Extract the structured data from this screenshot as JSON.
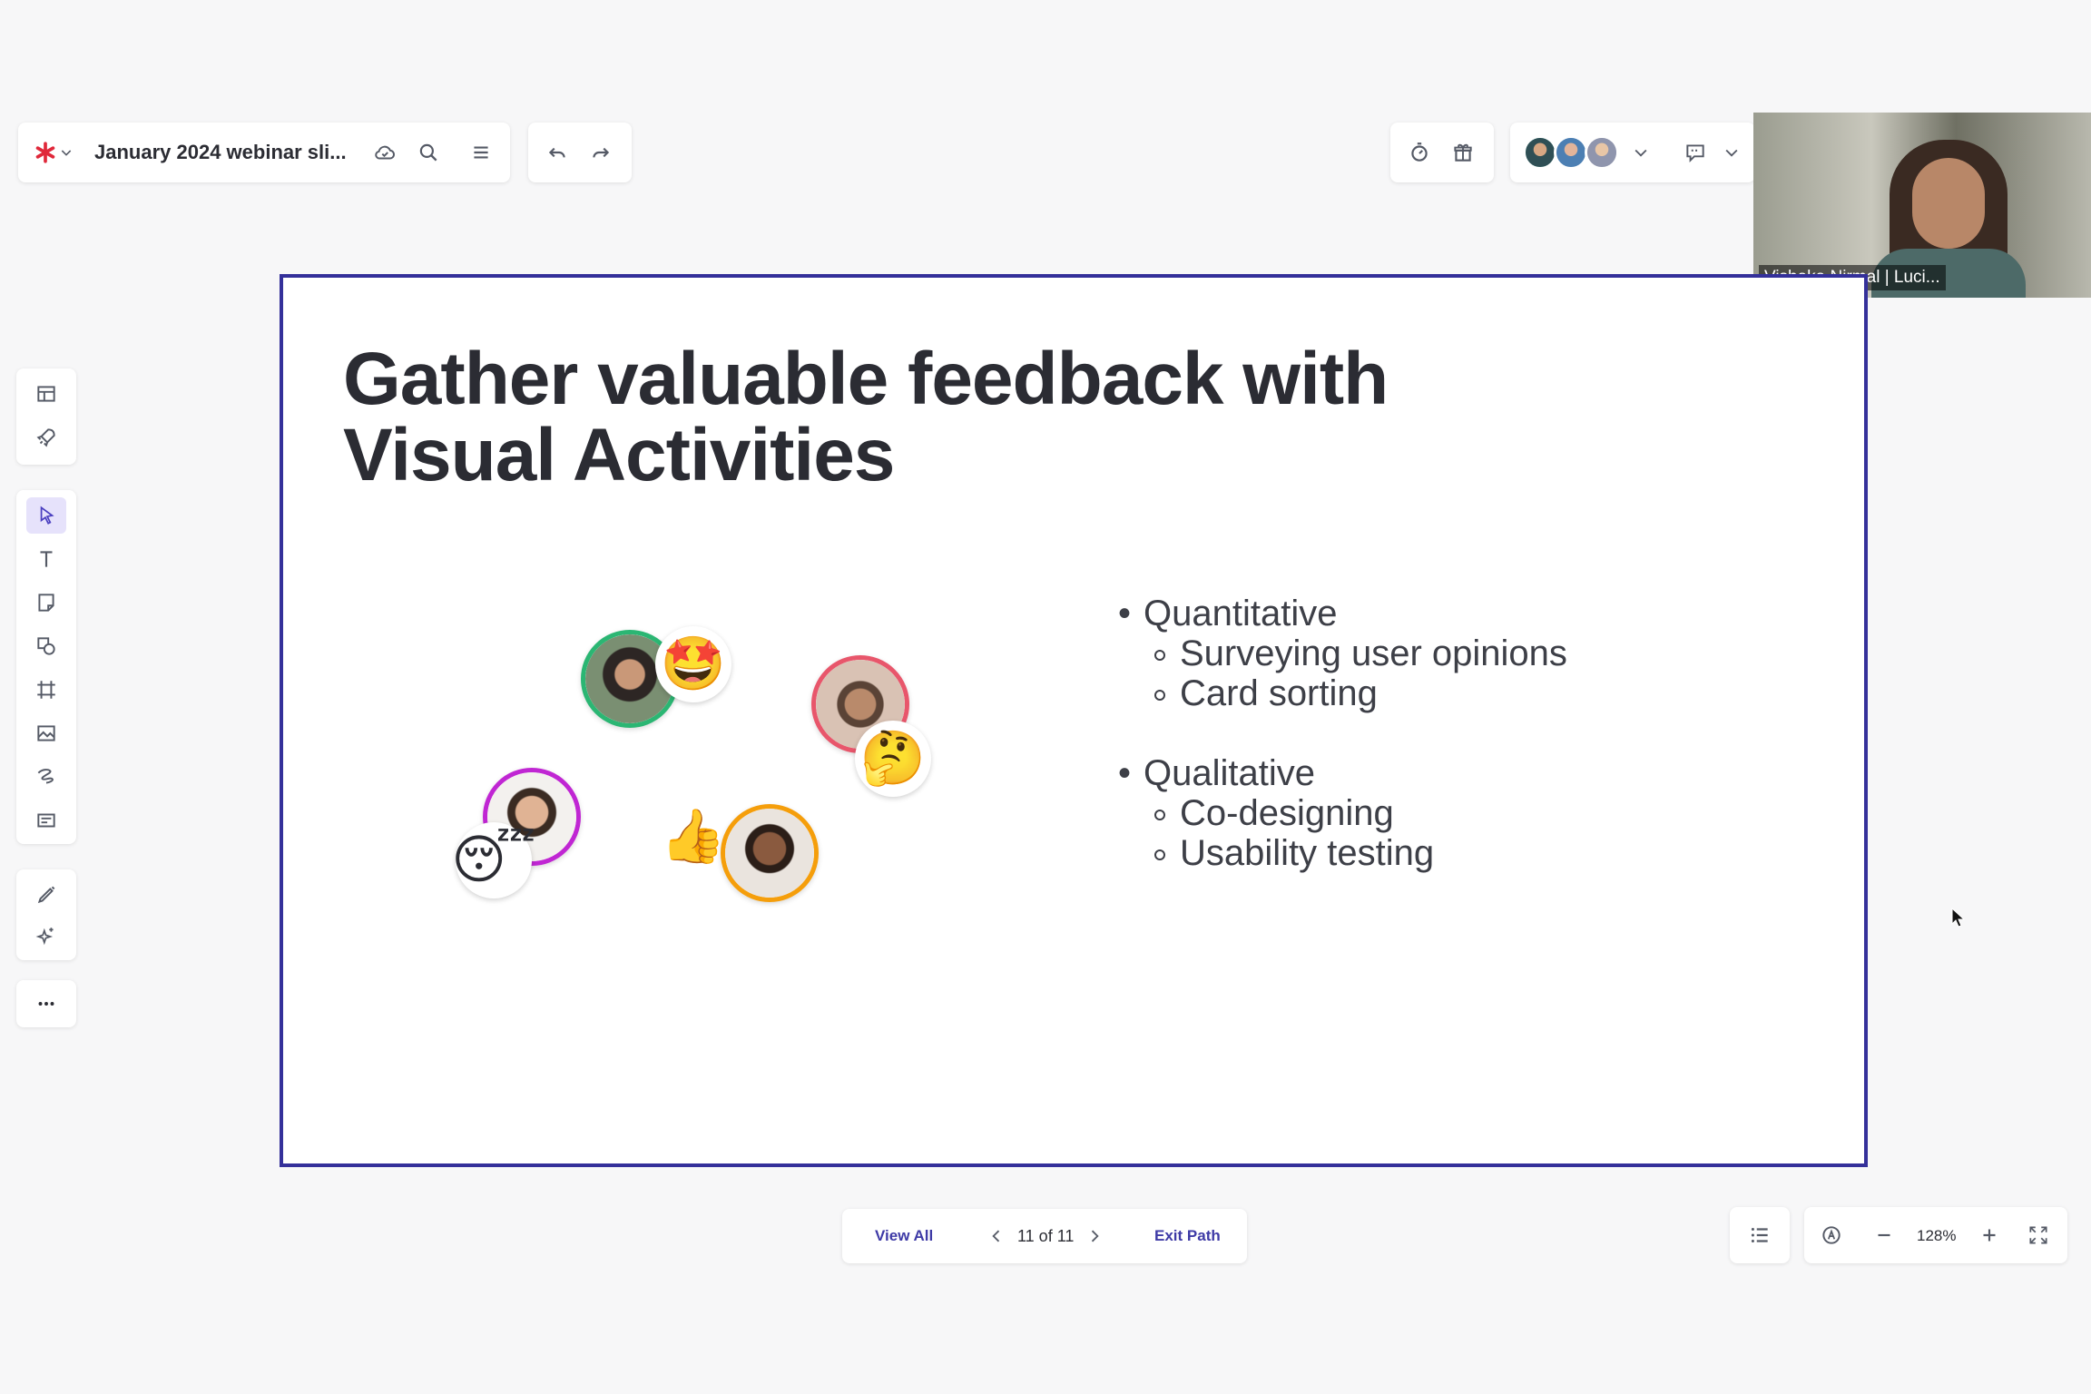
{
  "toolbar": {
    "doc_title": "January 2024 webinar sli...",
    "icons": [
      "lucid-logo-icon",
      "chevron-down-icon",
      "cloud-check-icon",
      "search-icon",
      "menu-icon",
      "undo-icon",
      "redo-icon",
      "timer-icon",
      "gift-icon",
      "chevron-down-icon",
      "comment-icon",
      "chevron-down-icon"
    ],
    "collaborator_count": 3
  },
  "video": {
    "participant_name": "Vishaka Nirmal | Luci..."
  },
  "left_tools": [
    "templates-icon",
    "rocket-icon",
    "pointer-icon",
    "text-icon",
    "sticky-note-icon",
    "shapes-icon",
    "frame-icon",
    "image-icon",
    "draw-icon",
    "card-icon",
    "pen-icon",
    "sparkle-icon",
    "more-icon"
  ],
  "slide": {
    "title_line1": "Gather valuable feedback with",
    "title_line2": "Visual Activities",
    "sections": [
      {
        "heading": "Quantitative",
        "items": [
          "Surveying user opinions",
          "Card sorting"
        ]
      },
      {
        "heading": "Qualitative",
        "items": [
          "Co-designing",
          "Usability testing"
        ]
      }
    ],
    "emojis": [
      "🤩",
      "🤔",
      "😴",
      "👍"
    ],
    "ring_colors": [
      "#2bb673",
      "#e8566b",
      "#c026d3",
      "#f59e0b"
    ]
  },
  "nav": {
    "view_all": "View All",
    "page_counter": "11 of 11",
    "exit_path": "Exit Path"
  },
  "zoom": {
    "level": "128%"
  },
  "colors": {
    "accent": "#34309a",
    "brand_red": "#e0283a"
  }
}
